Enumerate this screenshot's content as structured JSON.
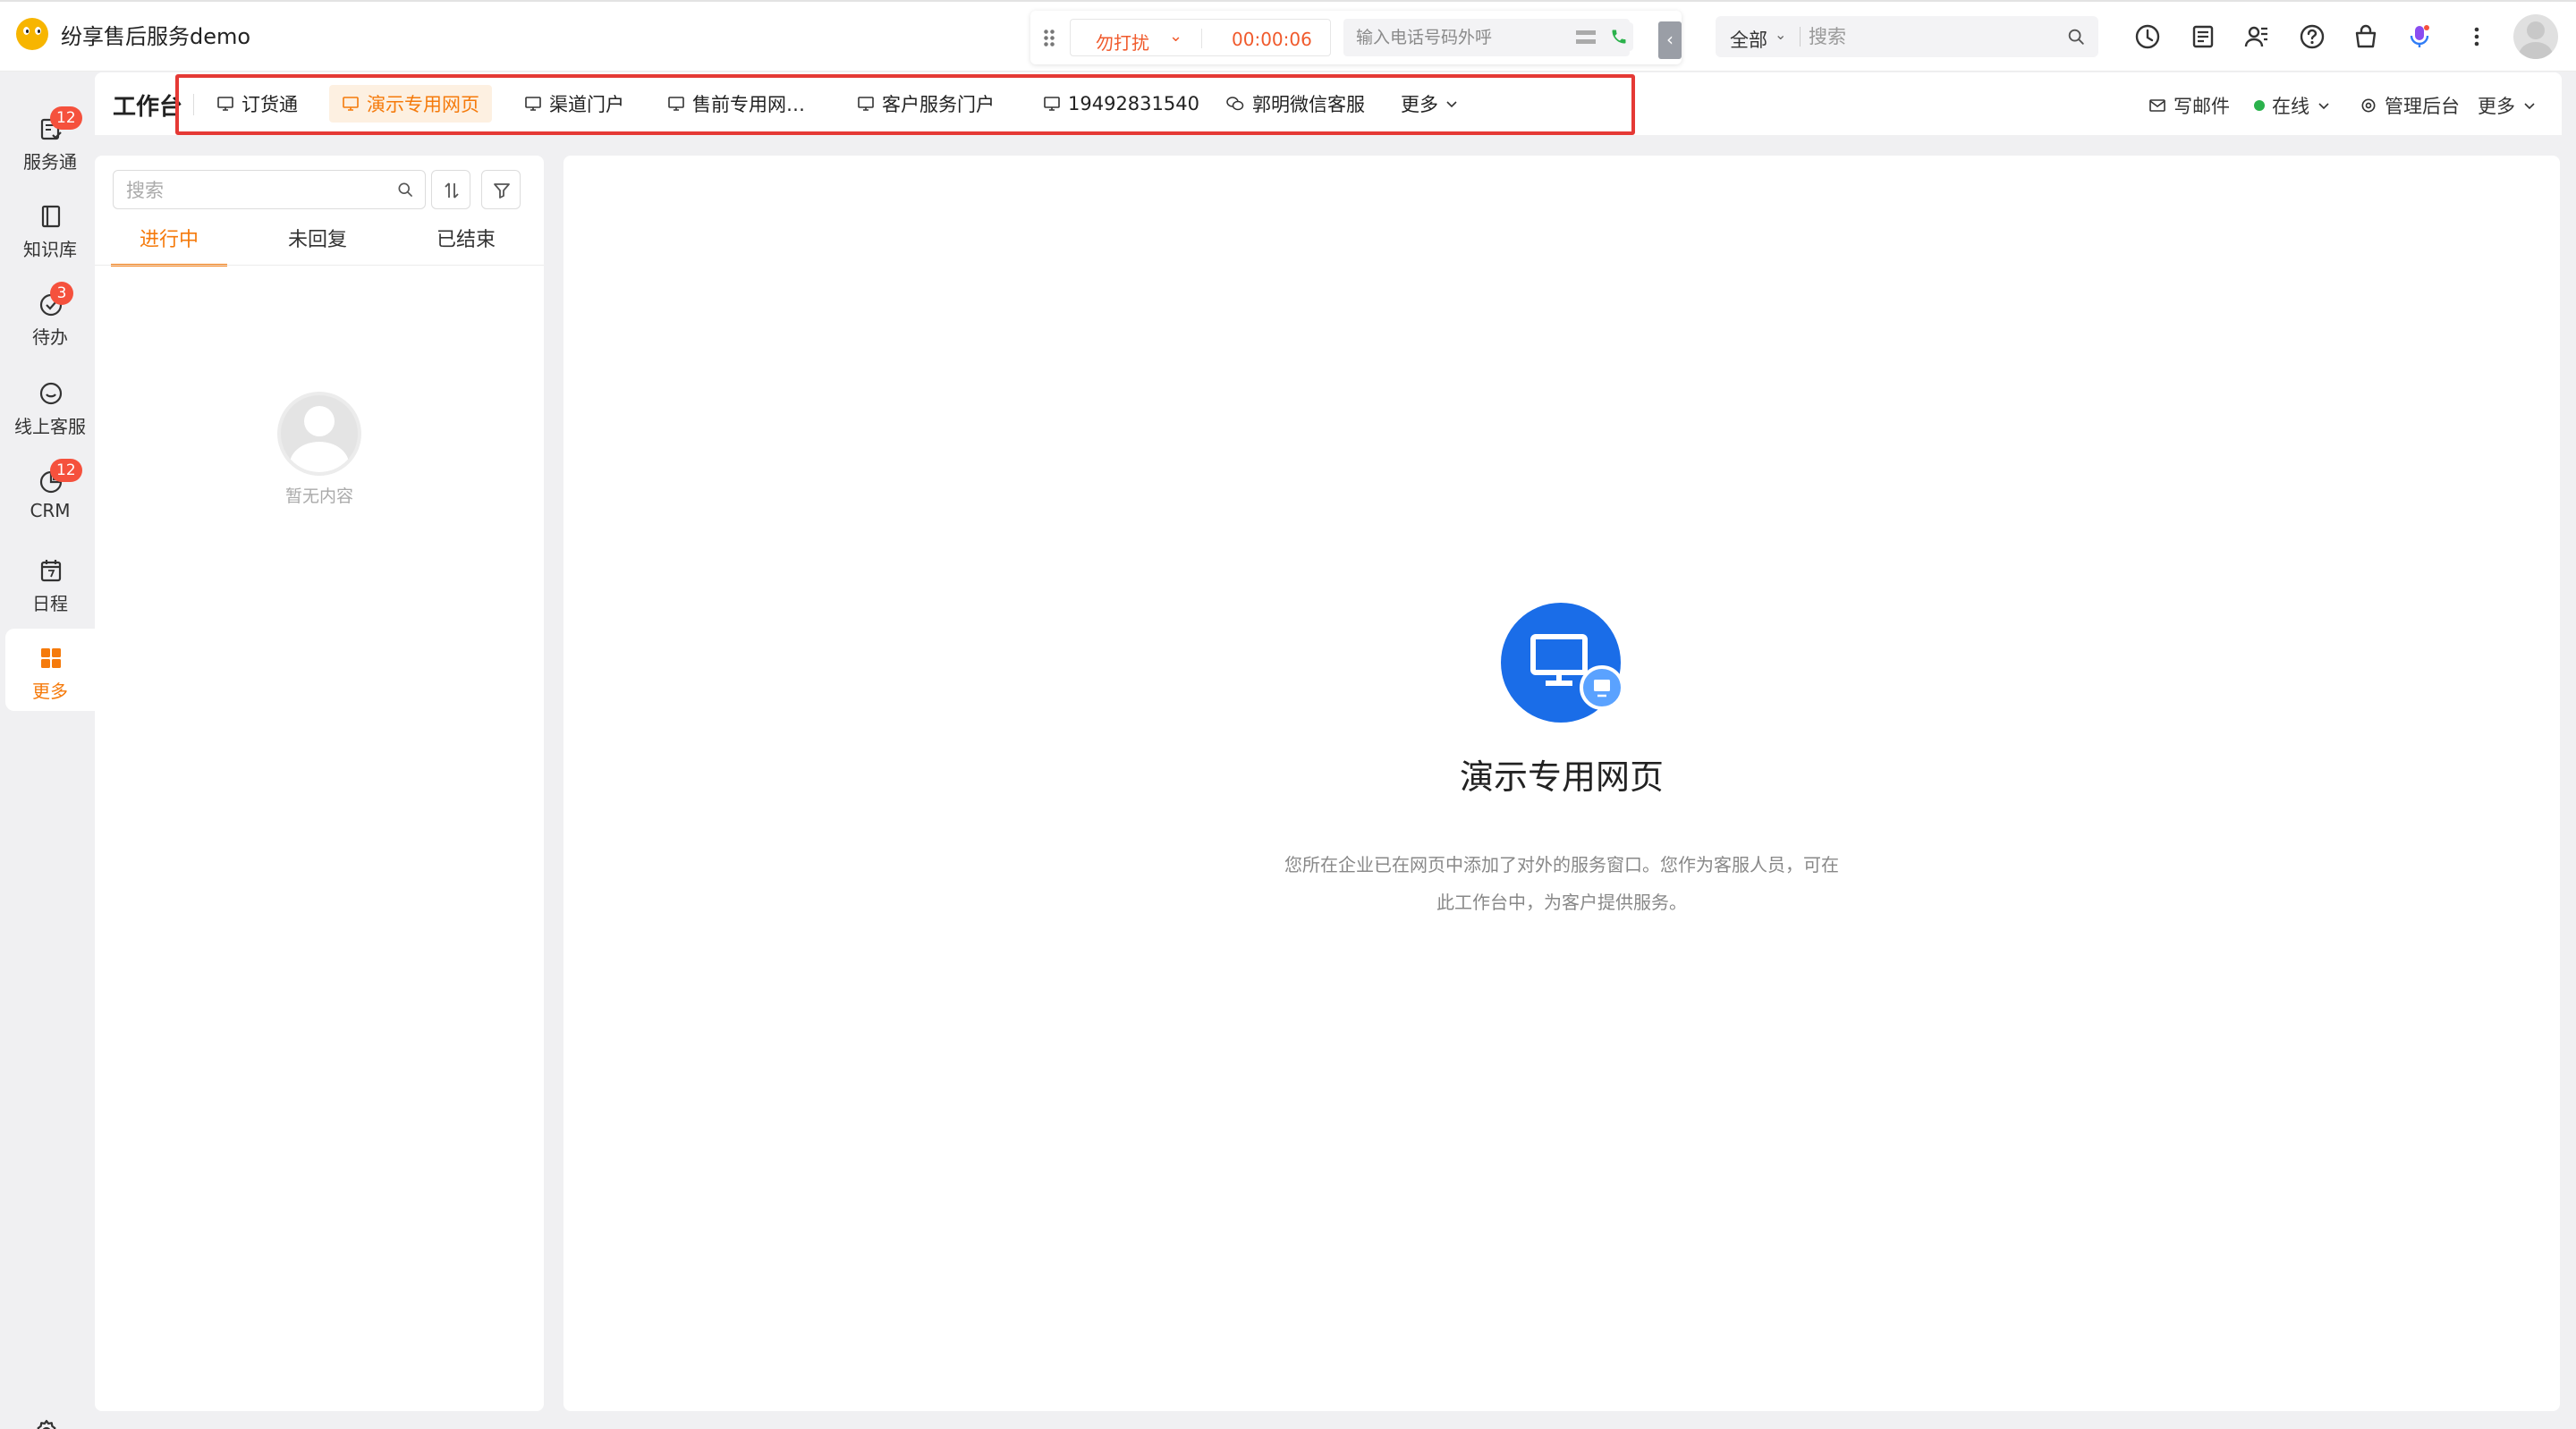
{
  "app": {
    "name": "纷享售后服务demo"
  },
  "callbar": {
    "status": "勿打扰",
    "timer": "00:00:06",
    "phone_placeholder": "输入电话号码外呼"
  },
  "global_search": {
    "scope": "全部",
    "placeholder": "搜索"
  },
  "toolbar_icons": [
    "history-icon",
    "notes-icon",
    "contacts-icon",
    "help-icon",
    "shop-icon",
    "microphone-icon",
    "more-vertical-icon",
    "user-avatar"
  ],
  "leftnav": {
    "items": [
      {
        "label": "服务通",
        "icon": "service-icon",
        "badge": "12"
      },
      {
        "label": "知识库",
        "icon": "book-icon",
        "badge": ""
      },
      {
        "label": "待办",
        "icon": "todo-check-icon",
        "badge": "3"
      },
      {
        "label": "线上客服",
        "icon": "chat-bubble-icon",
        "badge": ""
      },
      {
        "label": "CRM",
        "icon": "crm-pie-icon",
        "badge": "12"
      },
      {
        "label": "日程",
        "icon": "calendar-icon",
        "badge": ""
      },
      {
        "label": "更多",
        "icon": "grid-icon",
        "badge": ""
      }
    ],
    "active": "更多"
  },
  "workspace": {
    "title": "工作台",
    "tabs": [
      {
        "label": "订货通",
        "icon": "monitor-icon"
      },
      {
        "label": "演示专用网页",
        "icon": "monitor-icon",
        "active": true
      },
      {
        "label": "渠道门户",
        "icon": "monitor-icon"
      },
      {
        "label": "售前专用网…",
        "icon": "monitor-icon"
      },
      {
        "label": "客户服务门户",
        "icon": "monitor-icon"
      },
      {
        "label": "19492831540",
        "icon": "monitor-icon"
      },
      {
        "label": "郭明微信客服",
        "icon": "wechat-icon"
      }
    ],
    "more_label": "更多",
    "right": {
      "write_mail": "写邮件",
      "status": "在线",
      "admin": "管理后台",
      "more": "更多"
    }
  },
  "conversation_list": {
    "search_placeholder": "搜索",
    "tabs": [
      "进行中",
      "未回复",
      "已结束"
    ],
    "active_tab": "进行中",
    "empty_text": "暂无内容"
  },
  "main": {
    "title": "演示专用网页",
    "description": "您所在企业已在网页中添加了对外的服务窗口。您作为客服人员，可在此工作台中，为客户提供服务。"
  },
  "colors": {
    "accent": "#f57a0b",
    "danger_status": "#f05a2c",
    "badge": "#f5513d",
    "hero_blue": "#1a6de8",
    "highlight_box": "#e53935",
    "online": "#2bb24c"
  }
}
